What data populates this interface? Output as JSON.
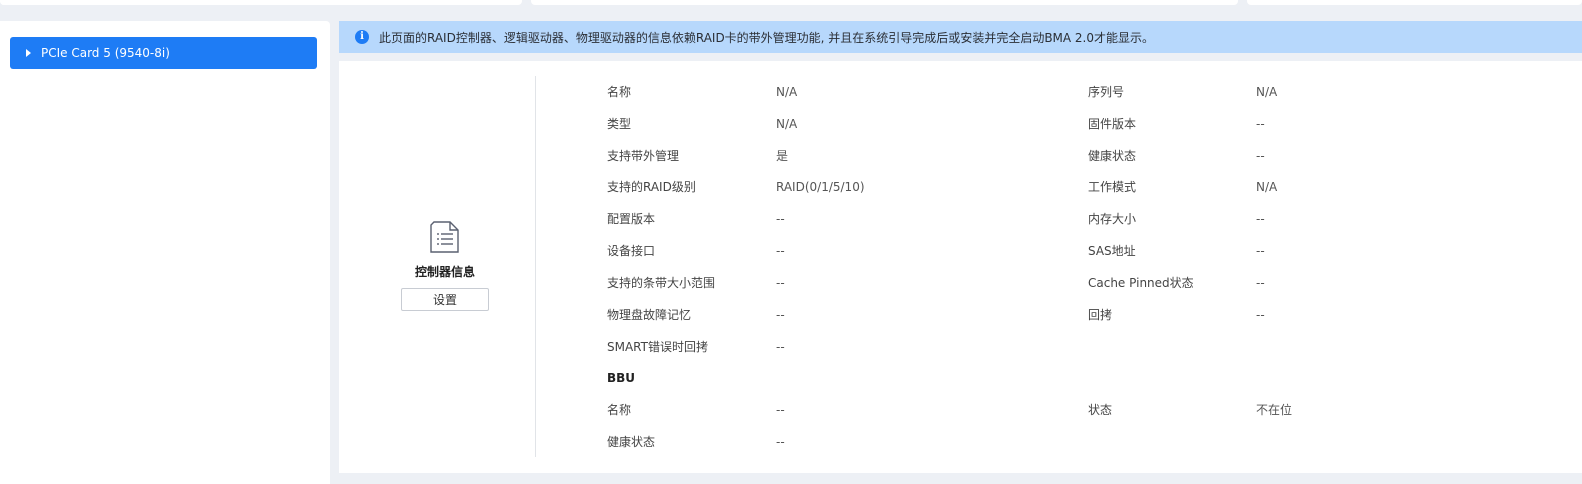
{
  "banner": {
    "text": "此页面的RAID控制器、逻辑驱动器、物理驱动器的信息依赖RAID卡的带外管理功能, 并且在系统引导完成后或安装并完全启动BMA 2.0才能显示。"
  },
  "sidebar": {
    "items": [
      {
        "label": "PCIe Card 5 (9540-8i)"
      }
    ]
  },
  "controller": {
    "title": "控制器信息",
    "settings_label": "设置"
  },
  "info": {
    "name_label": "名称",
    "name_value": "N/A",
    "serial_label": "序列号",
    "serial_value": "N/A",
    "type_label": "类型",
    "type_value": "N/A",
    "firmware_label": "固件版本",
    "firmware_value": "--",
    "oob_label": "支持带外管理",
    "oob_value": "是",
    "health_label": "健康状态",
    "health_value": "--",
    "raid_label": "支持的RAID级别",
    "raid_value": "RAID(0/1/5/10)",
    "mode_label": "工作模式",
    "mode_value": "N/A",
    "config_label": "配置版本",
    "config_value": "--",
    "memory_label": "内存大小",
    "memory_value": "--",
    "interface_label": "设备接口",
    "interface_value": "--",
    "sas_label": "SAS地址",
    "sas_value": "--",
    "stripe_label": "支持的条带大小范围",
    "stripe_value": "--",
    "cache_label": "Cache Pinned状态",
    "cache_value": "--",
    "fault_label": "物理盘故障记忆",
    "fault_value": "--",
    "copyback_label": "回拷",
    "copyback_value": "--",
    "smart_label": "SMART错误时回拷",
    "smart_value": "--"
  },
  "bbu": {
    "heading": "BBU",
    "name_label": "名称",
    "name_value": "--",
    "status_label": "状态",
    "status_value": "不在位",
    "health_label": "健康状态",
    "health_value": "--"
  },
  "colors": {
    "accent": "#1e7cf5",
    "banner_bg": "#b7d8fc",
    "page_bg": "#edf0f5"
  }
}
